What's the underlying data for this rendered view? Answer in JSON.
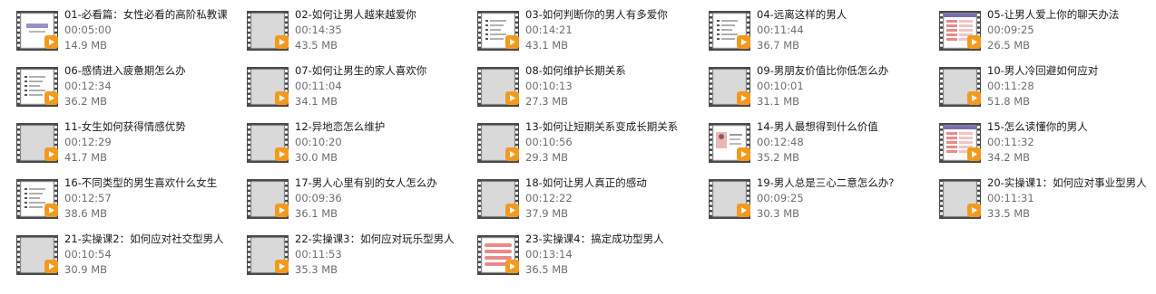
{
  "folder": {
    "view": "tiles",
    "files": [
      {
        "title": "01-必看篇：女性必看的高阶私教课",
        "duration": "00:05:00",
        "size": "14.9 MB",
        "thumbnail": "white-slide"
      },
      {
        "title": "02-如何让男人越来越爱你",
        "duration": "00:14:35",
        "size": "43.5 MB",
        "thumbnail": "grey-frame"
      },
      {
        "title": "03-如何判断你的男人有多爱你",
        "duration": "00:14:21",
        "size": "43.1 MB",
        "thumbnail": "text-slide"
      },
      {
        "title": "04-远离这样的男人",
        "duration": "00:11:44",
        "size": "36.7 MB",
        "thumbnail": "text-slide"
      },
      {
        "title": "05-让男人爱上你的聊天办法",
        "duration": "00:09:25",
        "size": "26.5 MB",
        "thumbnail": "pink-bars-slide"
      },
      {
        "title": "06-感情进入疲惫期怎么办",
        "duration": "00:12:34",
        "size": "36.2 MB",
        "thumbnail": "text-slide"
      },
      {
        "title": "07-如何让男生的家人喜欢你",
        "duration": "00:11:04",
        "size": "34.1 MB",
        "thumbnail": "grey-frame"
      },
      {
        "title": "08-如何维护长期关系",
        "duration": "00:10:13",
        "size": "27.3 MB",
        "thumbnail": "grey-frame"
      },
      {
        "title": "09-男朋友价值比你低怎么办",
        "duration": "00:10:01",
        "size": "31.1 MB",
        "thumbnail": "grey-frame"
      },
      {
        "title": "10-男人冷回避如何应对",
        "duration": "00:11:28",
        "size": "51.8 MB",
        "thumbnail": "grey-frame"
      },
      {
        "title": "11-女生如何获得情感优势",
        "duration": "00:12:29",
        "size": "41.7 MB",
        "thumbnail": "grey-frame"
      },
      {
        "title": "12-异地恋怎么维护",
        "duration": "00:10:20",
        "size": "30.0 MB",
        "thumbnail": "grey-frame"
      },
      {
        "title": "13-如何让短期关系变成长期关系",
        "duration": "00:10:56",
        "size": "29.3 MB",
        "thumbnail": "grey-frame"
      },
      {
        "title": "14-男人最想得到什么价值",
        "duration": "00:12:48",
        "size": "35.2 MB",
        "thumbnail": "photo-slide"
      },
      {
        "title": "15-怎么读懂你的男人",
        "duration": "00:11:32",
        "size": "34.2 MB",
        "thumbnail": "pink-bars-slide"
      },
      {
        "title": "16-不同类型的男生喜欢什么女生",
        "duration": "00:12:57",
        "size": "38.6 MB",
        "thumbnail": "text-slide"
      },
      {
        "title": "17-男人心里有别的女人怎么办",
        "duration": "00:09:36",
        "size": "36.1 MB",
        "thumbnail": "grey-frame"
      },
      {
        "title": "18-如何让男人真正的感动",
        "duration": "00:12:22",
        "size": "37.9 MB",
        "thumbnail": "grey-frame"
      },
      {
        "title": "19-男人总是三心二意怎么办?",
        "duration": "00:09:25",
        "size": "30.3 MB",
        "thumbnail": "grey-frame"
      },
      {
        "title": "20-实操课1：如何应对事业型男人",
        "duration": "00:11:31",
        "size": "33.5 MB",
        "thumbnail": "grey-frame"
      },
      {
        "title": "21-实操课2：如何应对社交型男人",
        "duration": "00:10:54",
        "size": "30.9 MB",
        "thumbnail": "grey-frame"
      },
      {
        "title": "22-实操课3：如何应对玩乐型男人",
        "duration": "00:11:53",
        "size": "35.3 MB",
        "thumbnail": "grey-frame"
      },
      {
        "title": "23-实操课4：搞定成功型男人",
        "duration": "00:13:14",
        "size": "36.5 MB",
        "thumbnail": "pink-stripes-slide"
      }
    ]
  },
  "colors": {
    "play_badge": "#f39a1e",
    "film_strip": "#4a4a4a",
    "frame_grey": "#d9d9d9",
    "title_text": "#1a1a1a",
    "meta_text": "#6e6e6e",
    "slide_pink": "#e88a8a",
    "slide_purple": "#7a6bb5"
  }
}
